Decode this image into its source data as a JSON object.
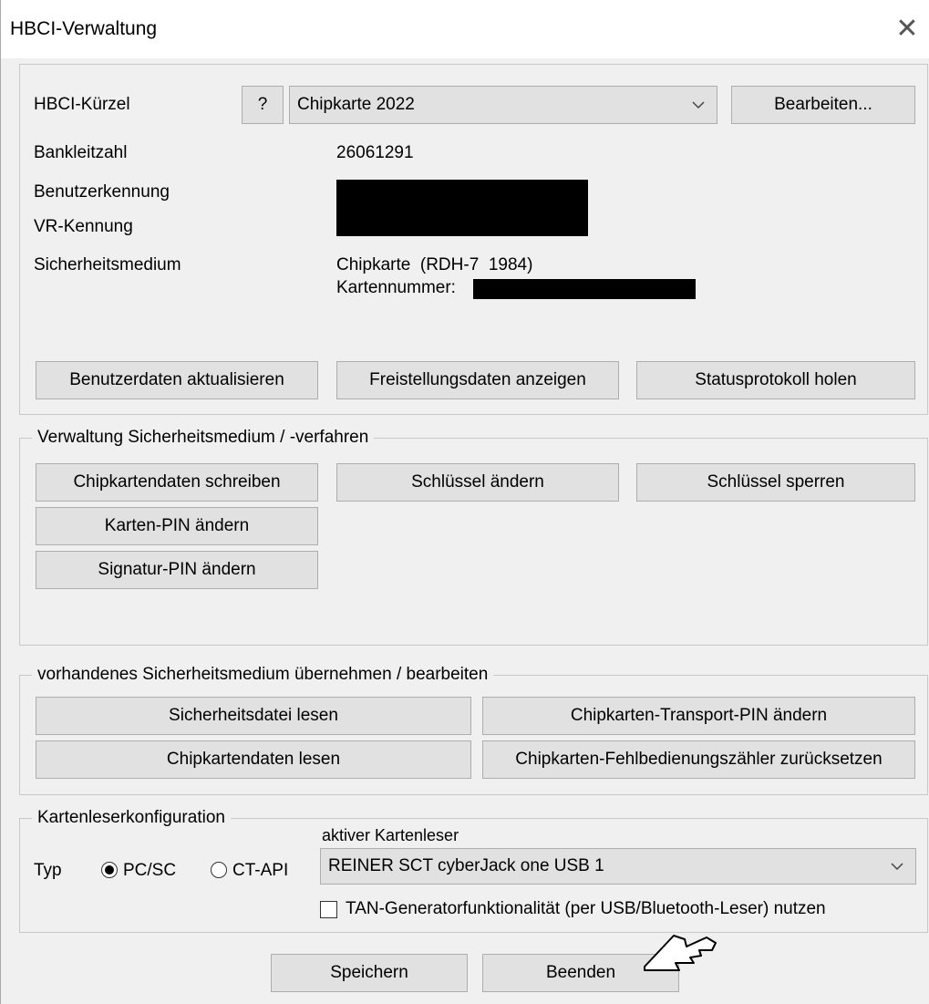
{
  "window": {
    "title": "HBCI-Verwaltung"
  },
  "account": {
    "kuerzel_label": "HBCI-Kürzel",
    "help_label": "?",
    "kuerzel_value": "Chipkarte 2022",
    "edit_label": "Bearbeiten...",
    "blz_label": "Bankleitzahl",
    "blz_value": "26061291",
    "user_label": "Benutzerkennung",
    "vr_label": "VR-Kennung",
    "medium_label": "Sicherheitsmedium",
    "medium_value": "Chipkarte  (RDH-7  1984)",
    "card_number_label": "Kartennummer:",
    "btn_update": "Benutzerdaten aktualisieren",
    "btn_freistellung": "Freistellungsdaten anzeigen",
    "btn_status": "Statusprotokoll holen"
  },
  "medium_admin": {
    "legend": "Verwaltung Sicherheitsmedium / -verfahren",
    "btn_write": "Chipkartendaten schreiben",
    "btn_change_key": "Schlüssel ändern",
    "btn_lock_key": "Schlüssel sperren",
    "btn_card_pin": "Karten-PIN ändern",
    "btn_sig_pin": "Signatur-PIN ändern"
  },
  "existing_medium": {
    "legend": "vorhandenes Sicherheitsmedium übernehmen / bearbeiten",
    "btn_read_file": "Sicherheitsdatei lesen",
    "btn_transport_pin": "Chipkarten-Transport-PIN ändern",
    "btn_read_card": "Chipkartendaten lesen",
    "btn_reset_counter": "Chipkarten-Fehlbedienungszähler zurücksetzen"
  },
  "reader": {
    "legend": "Kartenleserkonfiguration",
    "type_label": "Typ",
    "radio_pcsc": "PC/SC",
    "radio_ctapi": "CT-API",
    "pcsc_selected": true,
    "active_label": "aktiver Kartenleser",
    "active_value": "REINER SCT cyberJack one USB 1",
    "tan_label": "TAN-Generatorfunktionalität (per USB/Bluetooth-Leser) nutzen",
    "tan_checked": false
  },
  "footer": {
    "save_label": "Speichern",
    "close_label": "Beenden"
  }
}
